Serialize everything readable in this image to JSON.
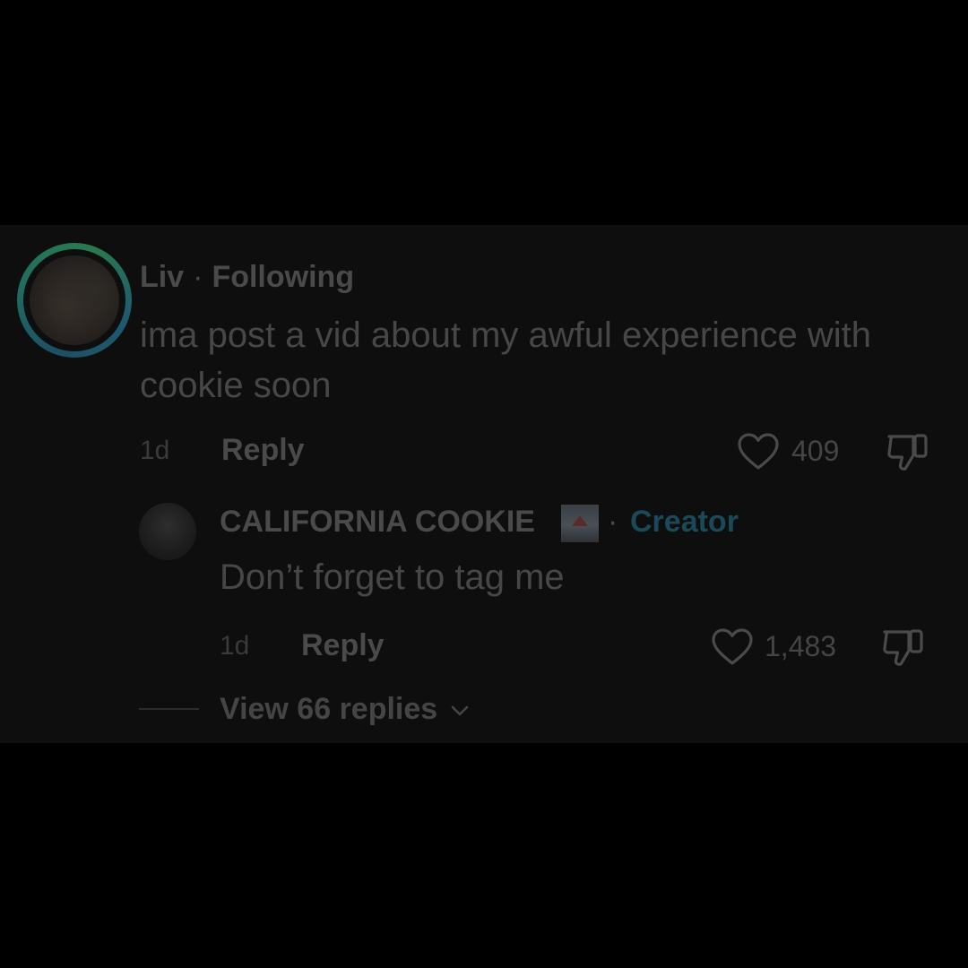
{
  "comment": {
    "username": "Liv",
    "separator": "·",
    "relationship": "Following",
    "text": "ima post a vid about my awful experience with cookie soon",
    "time": "1d",
    "reply_label": "Reply",
    "like_count": "409"
  },
  "reply": {
    "username": "CALIFORNIA COOKIE",
    "separator": "·",
    "role": "Creator",
    "text": "Don’t forget to tag me",
    "time": "1d",
    "reply_label": "Reply",
    "like_count": "1,483"
  },
  "thread": {
    "view_replies_label": "View 66 replies"
  },
  "icons": {
    "like": "heart-icon",
    "dislike": "thumbs-down-icon",
    "expand": "chevron-down-icon"
  },
  "colors": {
    "background": "#000000",
    "panel": "#0e0e0e",
    "text": "#474747",
    "creator_accent": "#1a4a5a"
  }
}
